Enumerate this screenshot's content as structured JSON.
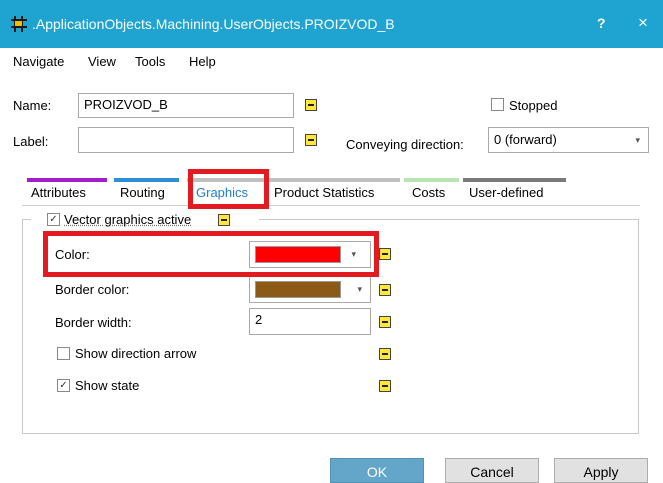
{
  "window": {
    "title": ".ApplicationObjects.Machining.UserObjects.PROIZVOD_B",
    "help_label": "?",
    "close_label": "×"
  },
  "menu": {
    "items": [
      "Navigate",
      "View",
      "Tools",
      "Help"
    ]
  },
  "form": {
    "name_label": "Name:",
    "name_value": "PROIZVOD_B",
    "label_label": "Label:",
    "label_value": "",
    "stopped_label": "Stopped",
    "stopped_checked": false,
    "conveying_label": "Conveying direction:",
    "conveying_value": "0 (forward)"
  },
  "tabs": [
    {
      "label": "Attributes",
      "color": "#a31ec8"
    },
    {
      "label": "Routing",
      "color": "#2f8fd6"
    },
    {
      "label": "Graphics",
      "color": "#c0c0c0"
    },
    {
      "label": "Product Statistics",
      "color": "#c0c0c0"
    },
    {
      "label": "Costs",
      "color": "#b9e5b5"
    },
    {
      "label": "User-defined",
      "color": "#7a7a7a"
    }
  ],
  "active_tab": "Graphics",
  "graphics": {
    "vector_label": "Vector graphics active",
    "vector_checked": true,
    "color_label": "Color:",
    "color_value": "#ff0000",
    "border_color_label": "Border color:",
    "border_color_value": "#8b5a16",
    "border_width_label": "Border width:",
    "border_width_value": "2",
    "show_direction_label": "Show direction arrow",
    "show_direction_checked": false,
    "show_state_label": "Show state",
    "show_state_checked": true
  },
  "buttons": {
    "ok": "OK",
    "cancel": "Cancel",
    "apply": "Apply"
  },
  "highlight_color": "#e21b23"
}
